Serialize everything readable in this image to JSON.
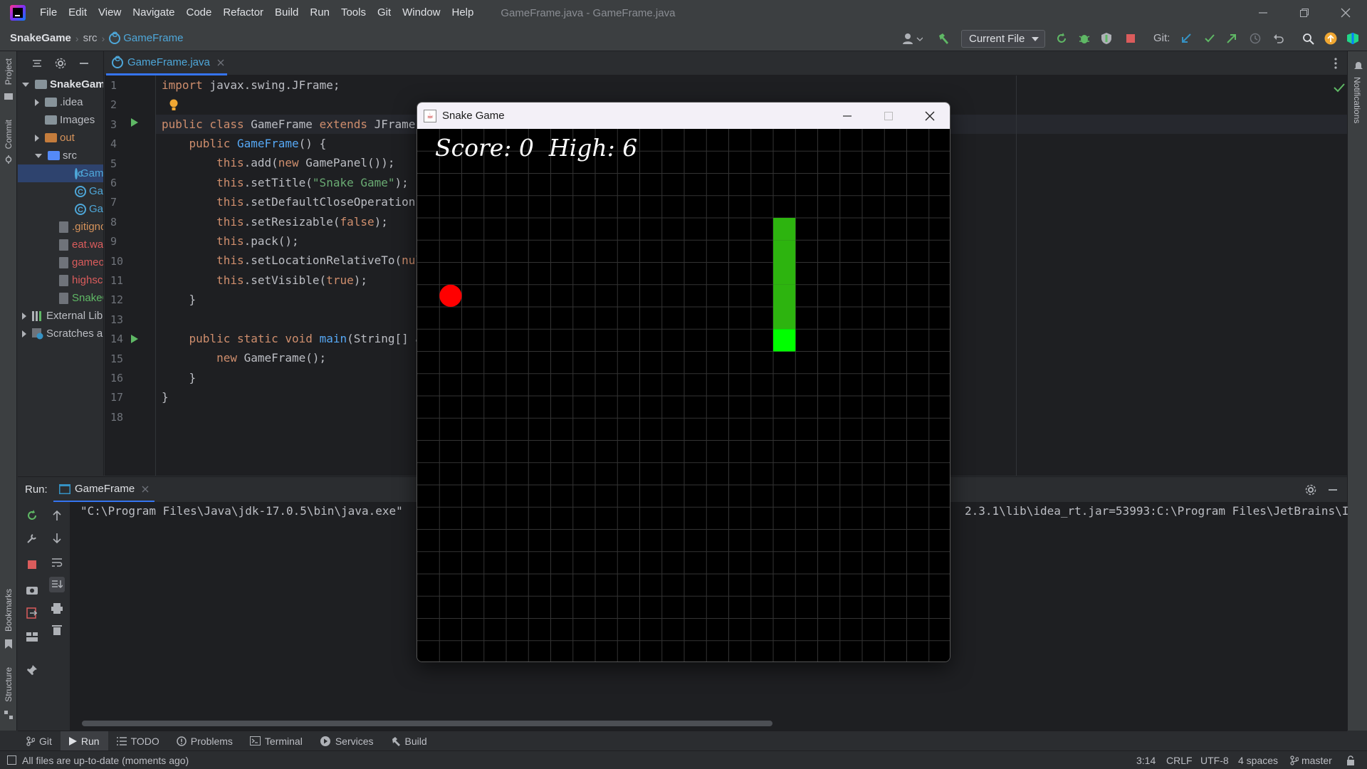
{
  "titlebar": {
    "menu": [
      "File",
      "Edit",
      "View",
      "Navigate",
      "Code",
      "Refactor",
      "Build",
      "Run",
      "Tools",
      "Git",
      "Window",
      "Help"
    ],
    "window_title": "GameFrame.java - GameFrame.java"
  },
  "navbar": {
    "project": "SnakeGame",
    "folder": "src",
    "file": "GameFrame",
    "run_config": "Current File",
    "git_label": "Git:"
  },
  "left_stripe": {
    "project": "Project",
    "commit": "Commit",
    "bookmarks": "Bookmarks",
    "structure": "Structure"
  },
  "right_stripe": {
    "notifications": "Notifications"
  },
  "project_tree": [
    {
      "label": "SnakeGame",
      "kind": "module"
    },
    {
      "label": ".idea",
      "kind": "folder"
    },
    {
      "label": "Images",
      "kind": "folder"
    },
    {
      "label": "out",
      "kind": "folder-orange"
    },
    {
      "label": "src",
      "kind": "folder-blue"
    },
    {
      "label": "GameFrame",
      "kind": "class"
    },
    {
      "label": "GamePanel",
      "kind": "class"
    },
    {
      "label": "GameMain",
      "kind": "class"
    },
    {
      "label": ".gitignore",
      "kind": "file"
    },
    {
      "label": "eat.wav",
      "kind": "file"
    },
    {
      "label": "gameover.wav",
      "kind": "file"
    },
    {
      "label": "highscore.txt",
      "kind": "file"
    },
    {
      "label": "SnakeGame.iml",
      "kind": "file"
    },
    {
      "label": "External Libraries",
      "kind": "lib"
    },
    {
      "label": "Scratches and Consoles",
      "kind": "scratch"
    }
  ],
  "editor": {
    "tab_label": "GameFrame.java",
    "line_numbers": [
      "1",
      "2",
      "3",
      "4",
      "5",
      "6",
      "7",
      "8",
      "9",
      "10",
      "11",
      "12",
      "13",
      "14",
      "15",
      "16",
      "17",
      "18"
    ]
  },
  "run": {
    "label": "Run:",
    "tab": "GameFrame",
    "console_left": "\"C:\\Program Files\\Java\\jdk-17.0.5\\bin\\java.exe\"",
    "console_right": "2.3.1\\lib\\idea_rt.jar=53993:C:\\Program Files\\JetBrains\\I"
  },
  "bottom_tabs": [
    "Git",
    "Run",
    "TODO",
    "Problems",
    "Terminal",
    "Services",
    "Build"
  ],
  "status": {
    "message": "All files are up-to-date (moments ago)",
    "position": "3:14",
    "line_sep": "CRLF",
    "encoding": "UTF-8",
    "indent": "4 spaces",
    "branch": "master"
  },
  "snake_window": {
    "title": "Snake Game",
    "score_label": "Score:",
    "score": "0",
    "high_label": "High:",
    "high": "6"
  },
  "game": {
    "grid_cells": 24,
    "food": {
      "col": 1,
      "row": 7,
      "color": "#ff0000"
    },
    "snake_head": {
      "col": 16,
      "row": 9,
      "color": "#00ff00"
    },
    "snake_body": [
      {
        "col": 16,
        "row": 8
      },
      {
        "col": 16,
        "row": 7
      },
      {
        "col": 16,
        "row": 6
      },
      {
        "col": 16,
        "row": 5
      },
      {
        "col": 16,
        "row": 4
      }
    ],
    "body_color": "#2db40f"
  },
  "colors": {
    "accent": "#3574f0",
    "keyword": "#cf8e6d",
    "string": "#6aab73",
    "method": "#56a8f5"
  }
}
